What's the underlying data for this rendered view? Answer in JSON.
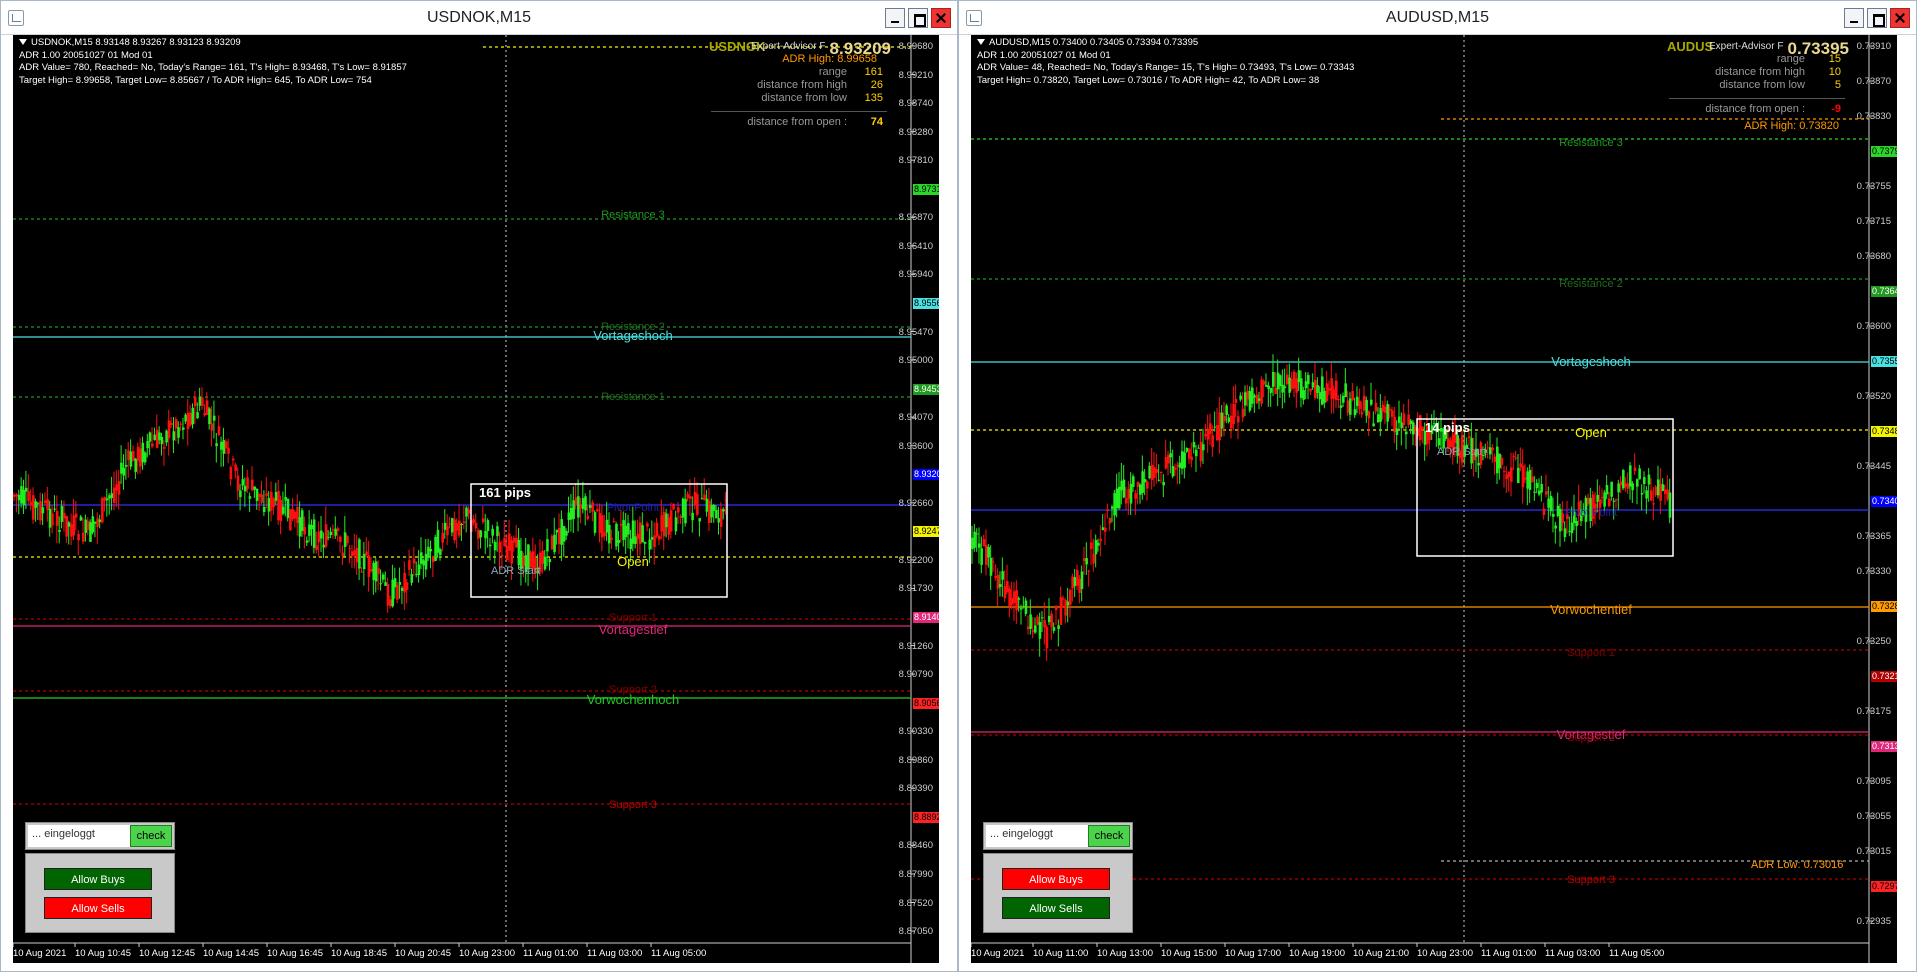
{
  "windows": [
    {
      "title": "USDNOK,M15",
      "info_line1": "USDNOK,M15  8.93148 8.93267 8.93123 8.93209",
      "info_line2": "ADR 1.00 20051027 01 Mod 01",
      "info_line3": "ADR Value= 780, Reached= No, Today's Range= 161, T's High= 8.93468, T's Low= 8.91857",
      "info_line4": "Target High= 8.99658, Target Low= 8.85667 / To ADR High= 645, To ADR Low= 754",
      "ea": {
        "symbol": "USDNOK",
        "big_price": "8.93209",
        "header": "Expert-Advisor F",
        "adr_high": "ADR High: 8.99658",
        "rows": [
          {
            "label": "range",
            "value": "161"
          },
          {
            "label": "distance from high",
            "value": "26"
          },
          {
            "label": "distance from low",
            "value": "135"
          }
        ],
        "open_label": "distance from open :",
        "open_value": "74"
      },
      "prices": [
        "8.99680",
        "8.99210",
        "8.98740",
        "8.98280",
        "8.97810",
        "8.97311",
        "8.96870",
        "8.96410",
        "8.95940",
        "8.95568",
        "8.95470",
        "8.95000",
        "8.94536",
        "8.94070",
        "8.93600",
        "8.93209",
        "8.92660",
        "8.92470",
        "8.92200",
        "8.91730",
        "8.91400",
        "8.91260",
        "8.90790",
        "8.90566",
        "8.90330",
        "8.89860",
        "8.89390",
        "8.88925",
        "8.88460",
        "8.87990",
        "8.87520",
        "8.87050"
      ],
      "level_labels": {
        "res3": "Resistance 3",
        "res2": "Resistance 2",
        "vortageshoch": "Vortageshoch",
        "res1": "Resistance 1",
        "pivot": "Pivot Point",
        "pips": "161 pips",
        "adr_start": "ADR Start",
        "open": "Open",
        "support1": "Support 1",
        "vortagestief": "Vortagestief",
        "support2": "Support 2",
        "vorwochenhoch": "Vorwochenhoch",
        "support3": "Support 3"
      },
      "times": [
        "10 Aug 2021",
        "10 Aug 10:45",
        "10 Aug 12:45",
        "10 Aug 14:45",
        "10 Aug 16:45",
        "10 Aug 18:45",
        "10 Aug 20:45",
        "10 Aug 23:00",
        "11 Aug 01:00",
        "11 Aug 03:00",
        "11 Aug 05:00"
      ],
      "panel": {
        "status": "... eingeloggt",
        "check": "check",
        "buy": "Allow Buys",
        "sell": "Allow Sells",
        "buy_color": "#006400",
        "sell_color": "#ff0000"
      }
    },
    {
      "title": "AUDUSD,M15",
      "info_line1": "AUDUSD,M15  0.73400 0.73405 0.73394 0.73395",
      "info_line2": "ADR 1.00 20051027 01 Mod 01",
      "info_line3": "ADR Value= 48, Reached= No, Today's Range= 15, T's High= 0.73493, T's Low= 0.73343",
      "info_line4": "Target High= 0.73820, Target Low= 0.73016 / To ADR High= 42, To ADR Low= 38",
      "ea": {
        "symbol": "AUDUS",
        "big_price": "0.73395",
        "header": "Expert-Advisor F",
        "adr_high": "ADR High: 0.73820",
        "adr_low": "ADR Low: 0.73016",
        "rows": [
          {
            "label": "range",
            "value": "15"
          },
          {
            "label": "distance from high",
            "value": "10"
          },
          {
            "label": "distance from low",
            "value": "5"
          }
        ],
        "open_label": "distance from open :",
        "open_value": "-9"
      },
      "prices": [
        "0.73910",
        "0.73870",
        "0.73830",
        "0.73799",
        "0.73755",
        "0.73715",
        "0.73680",
        "0.73640",
        "0.73600",
        "0.73559",
        "0.73520",
        "0.73483",
        "0.73445",
        "0.73405",
        "0.73365",
        "0.73330",
        "0.73289",
        "0.73250",
        "0.73213",
        "0.73175",
        "0.73135",
        "0.73095",
        "0.73055",
        "0.73015",
        "0.72975",
        "0.72935"
      ],
      "level_labels": {
        "res3": "Resistance 3",
        "res2": "Resistance 2",
        "vortageshoch": "Vortageshoch",
        "pips": "14 pips",
        "adr_start": "ADR Start",
        "open": "Open",
        "pivot": "Pivot Point",
        "vorwochentief": "Vorwochentief",
        "support1": "Support 1",
        "vortagestief": "Vortagestief",
        "support2": "Support 2",
        "support3": "Support 3"
      },
      "times": [
        "10 Aug 2021",
        "10 Aug 11:00",
        "10 Aug 13:00",
        "10 Aug 15:00",
        "10 Aug 17:00",
        "10 Aug 19:00",
        "10 Aug 21:00",
        "10 Aug 23:00",
        "11 Aug 01:00",
        "11 Aug 03:00",
        "11 Aug 05:00"
      ],
      "panel": {
        "status": "... eingeloggt",
        "check": "check",
        "buy": "Allow Buys",
        "sell": "Allow Sells",
        "buy_color": "#ff0000",
        "sell_color": "#006400"
      }
    }
  ]
}
